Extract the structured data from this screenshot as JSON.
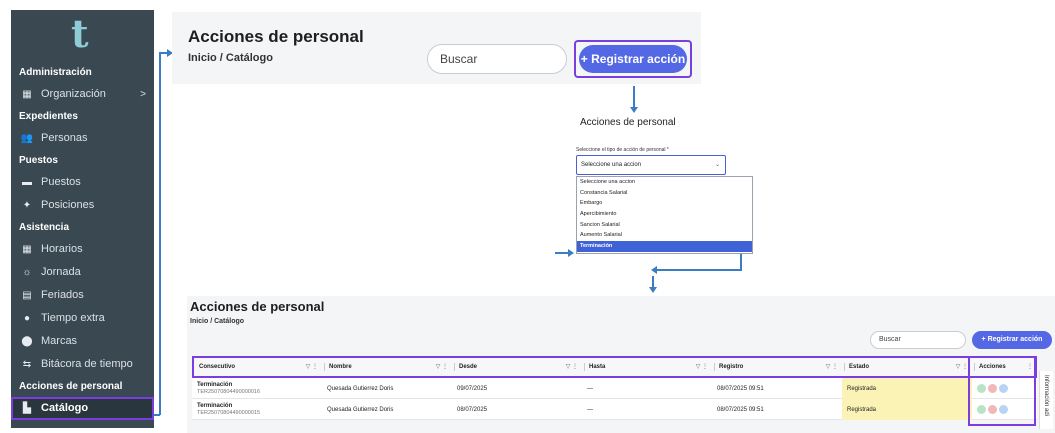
{
  "sidebar": {
    "logo_glyph": "t",
    "items": [
      {
        "type": "section",
        "label": "Administración"
      },
      {
        "type": "item",
        "label": "Organización",
        "icon": "building-icon",
        "glyph": "▦",
        "chevron": ">"
      },
      {
        "type": "section",
        "label": "Expedientes"
      },
      {
        "type": "item",
        "label": "Personas",
        "icon": "people-icon",
        "glyph": "👥"
      },
      {
        "type": "section",
        "label": "Puestos"
      },
      {
        "type": "item",
        "label": "Puestos",
        "icon": "briefcase-icon",
        "glyph": "▬"
      },
      {
        "type": "item",
        "label": "Posiciones",
        "icon": "position-icon",
        "glyph": "✦"
      },
      {
        "type": "section",
        "label": "Asistencia"
      },
      {
        "type": "item",
        "label": "Horarios",
        "icon": "calendar-icon",
        "glyph": "▦"
      },
      {
        "type": "item",
        "label": "Jornada",
        "icon": "sun-clock-icon",
        "glyph": "☼"
      },
      {
        "type": "item",
        "label": "Feriados",
        "icon": "calendar-day-icon",
        "glyph": "▤"
      },
      {
        "type": "item",
        "label": "Tiempo extra",
        "icon": "clock-icon",
        "glyph": "●"
      },
      {
        "type": "item",
        "label": "Marcas",
        "icon": "location-pin-icon",
        "glyph": "⬤"
      },
      {
        "type": "item",
        "label": "Bitácora de tiempo",
        "icon": "timeline-icon",
        "glyph": "⇆"
      },
      {
        "type": "section",
        "label": "Acciones de personal"
      },
      {
        "type": "item",
        "label": "Catálogo",
        "icon": "folder-icon",
        "glyph": "▙",
        "active": true
      }
    ]
  },
  "top": {
    "title": "Acciones de personal",
    "breadcrumb": "Inicio / Catálogo",
    "search_placeholder": "Buscar",
    "register_label": "+ Registrar acción"
  },
  "modal": {
    "title": "Acciones de personal",
    "field_label": "Seleccione el tipo de acción de personal *",
    "selected_value": "Seleccione una accion",
    "options": [
      "Seleccione una accion",
      "Constancia Salarial",
      "Embargo",
      "Apercibimiento",
      "Sancion Salarial",
      "Aumento Salarial",
      "Terminación"
    ],
    "highlighted_option": "Terminación"
  },
  "bottom": {
    "title": "Acciones de personal",
    "breadcrumb": "Inicio / Catálogo",
    "search_placeholder": "Buscar",
    "register_label": "+ Registrar acción",
    "columns": [
      "Consecutivo",
      "Nombre",
      "Desde",
      "Hasta",
      "Registro",
      "Estado",
      "Acciones"
    ],
    "rows": [
      {
        "type": "Terminación",
        "code": "TER25070804490000016",
        "nombre": "Quesada Gutierrez Doris",
        "desde": "09/07/2025",
        "hasta": "—",
        "registro": "08/07/2025 09:51",
        "estado": "Registrada"
      },
      {
        "type": "Terminación",
        "code": "TER25070804490000015",
        "nombre": "Quesada Gutierrez Doris",
        "desde": "08/07/2025",
        "hasta": "—",
        "registro": "08/07/2025 09:51",
        "estado": "Registrada"
      }
    ],
    "side_tab": "Información adi"
  },
  "colors": {
    "sidebar_bg": "#3a4851",
    "accent_purple": "#7a3ee0",
    "button_blue": "#5468e6",
    "status_yellow": "#fbf3b6",
    "connector_blue": "#3b7dc4",
    "action_green": "#b9e3c8",
    "action_red": "#f2b8b8",
    "action_blue": "#b8d4f2"
  }
}
